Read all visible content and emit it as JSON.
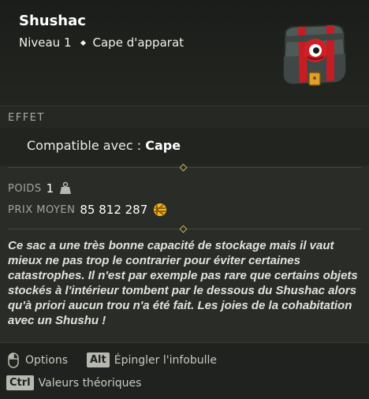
{
  "item": {
    "name": "Shushac",
    "level": "Niveau 1",
    "type": "Cape d'apparat",
    "icon": "bag-icon"
  },
  "effects_section": {
    "title": "EFFET",
    "compatible_label": "Compatible avec :",
    "compatible_value": "Cape"
  },
  "stats": {
    "weight_label": "POIDS",
    "weight_value": "1",
    "weight_icon": "weight-icon",
    "price_label": "PRIX MOYEN",
    "price_value": "85 812 287",
    "price_icon": "kama-icon"
  },
  "description": "Ce sac a une très bonne capacité de stockage mais il vaut mieux ne pas trop le contrarier pour éviter certaines catastrophes. Il n'est par exemple pas rare que certains objets stockés à l'intérieur tombent par le dessous du Shushac alors qu'à priori aucun trou n'a été fait. Les joies de la cohabitation avec un Shushu !",
  "footer": {
    "options_label": "Options",
    "alt_key": "Alt",
    "pin_label": "Épingler l'infobulle",
    "ctrl_key": "Ctrl",
    "theoretical_label": "Valeurs théoriques"
  },
  "colors": {
    "background": "#2a2c28",
    "accent_gold": "#f3b61f",
    "bag_red": "#d01f26"
  }
}
